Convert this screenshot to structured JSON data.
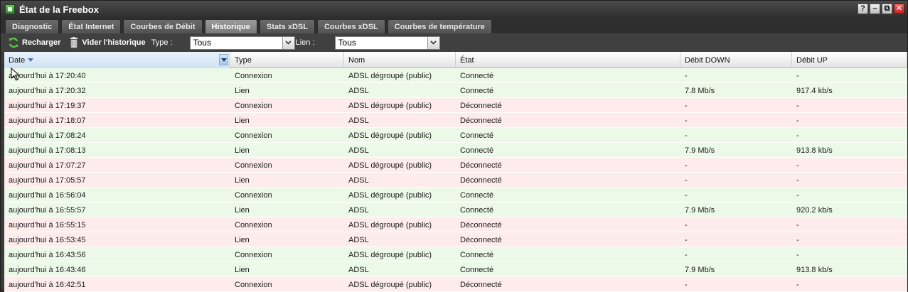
{
  "window": {
    "title": "État de la Freebox",
    "buttons": [
      "?",
      "–",
      "⧉",
      "✕"
    ]
  },
  "tabs": [
    {
      "label": "Diagnostic",
      "active": false
    },
    {
      "label": "État Internet",
      "active": false
    },
    {
      "label": "Courbes de Débit",
      "active": false
    },
    {
      "label": "Historique",
      "active": true
    },
    {
      "label": "Stats xDSL",
      "active": false
    },
    {
      "label": "Courbes xDSL",
      "active": false
    },
    {
      "label": "Courbes de température",
      "active": false
    }
  ],
  "toolbar": {
    "reload_label": "Recharger",
    "clear_label": "Vider l'historique",
    "type_label": "Type :",
    "type_value": "Tous",
    "link_label": "Lien :",
    "link_value": "Tous"
  },
  "table": {
    "columns": [
      "Date",
      "Type",
      "Nom",
      "État",
      "Débit DOWN",
      "Débit UP"
    ],
    "rows": [
      {
        "status": "ok",
        "cells": [
          "aujourd'hui à 17:20:40",
          "Connexion",
          "ADSL dégroupé (public)",
          "Connecté",
          "-",
          "-"
        ]
      },
      {
        "status": "ok",
        "cells": [
          "aujourd'hui à 17:20:32",
          "Lien",
          "ADSL",
          "Connecté",
          "7.8 Mb/s",
          "917.4 kb/s"
        ]
      },
      {
        "status": "ko",
        "cells": [
          "aujourd'hui à 17:19:37",
          "Connexion",
          "ADSL dégroupé (public)",
          "Déconnecté",
          "-",
          "-"
        ]
      },
      {
        "status": "ko",
        "cells": [
          "aujourd'hui à 17:18:07",
          "Lien",
          "ADSL",
          "Déconnecté",
          "-",
          "-"
        ]
      },
      {
        "status": "ok",
        "cells": [
          "aujourd'hui à 17:08:24",
          "Connexion",
          "ADSL dégroupé (public)",
          "Connecté",
          "-",
          "-"
        ]
      },
      {
        "status": "ok",
        "cells": [
          "aujourd'hui à 17:08:13",
          "Lien",
          "ADSL",
          "Connecté",
          "7.9 Mb/s",
          "913.8 kb/s"
        ]
      },
      {
        "status": "ko",
        "cells": [
          "aujourd'hui à 17:07:27",
          "Connexion",
          "ADSL dégroupé (public)",
          "Déconnecté",
          "-",
          "-"
        ]
      },
      {
        "status": "ko",
        "cells": [
          "aujourd'hui à 17:05:57",
          "Lien",
          "ADSL",
          "Déconnecté",
          "-",
          "-"
        ]
      },
      {
        "status": "ok",
        "cells": [
          "aujourd'hui à 16:56:04",
          "Connexion",
          "ADSL dégroupé (public)",
          "Connecté",
          "-",
          "-"
        ]
      },
      {
        "status": "ok",
        "cells": [
          "aujourd'hui à 16:55:57",
          "Lien",
          "ADSL",
          "Connecté",
          "7.9 Mb/s",
          "920.2 kb/s"
        ]
      },
      {
        "status": "ko",
        "cells": [
          "aujourd'hui à 16:55:15",
          "Connexion",
          "ADSL dégroupé (public)",
          "Déconnecté",
          "-",
          "-"
        ]
      },
      {
        "status": "ko",
        "cells": [
          "aujourd'hui à 16:53:45",
          "Lien",
          "ADSL",
          "Déconnecté",
          "-",
          "-"
        ]
      },
      {
        "status": "ok",
        "cells": [
          "aujourd'hui à 16:43:56",
          "Connexion",
          "ADSL dégroupé (public)",
          "Connecté",
          "-",
          "-"
        ]
      },
      {
        "status": "ok",
        "cells": [
          "aujourd'hui à 16:43:46",
          "Lien",
          "ADSL",
          "Connecté",
          "7.9 Mb/s",
          "913.8 kb/s"
        ]
      },
      {
        "status": "ko",
        "cells": [
          "aujourd'hui à 16:42:51",
          "Connexion",
          "ADSL dégroupé (public)",
          "Déconnecté",
          "-",
          "-"
        ]
      }
    ]
  },
  "colors": {
    "connected_row": "#ecf9e8",
    "disconnected_row": "#fdeceb"
  }
}
